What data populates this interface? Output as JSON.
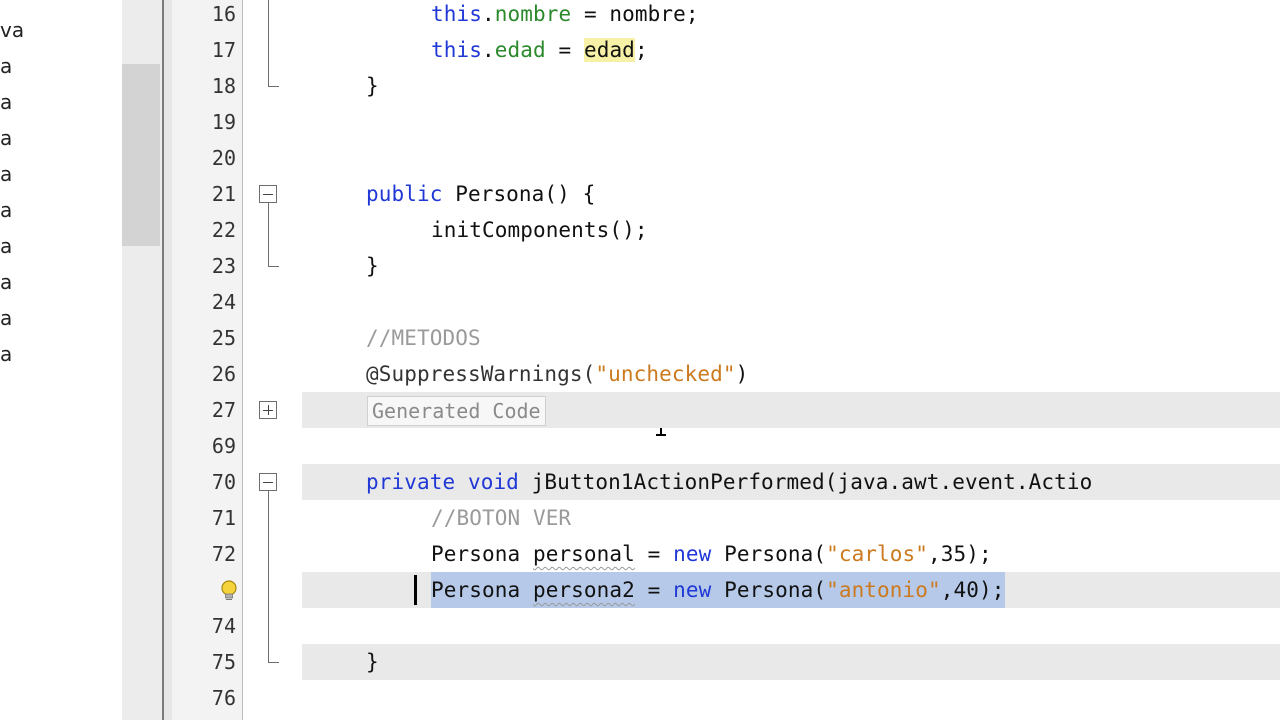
{
  "project_panel": {
    "items": [
      "va",
      "a",
      "a",
      "a",
      "a",
      "a",
      "a",
      "a",
      "a",
      "a"
    ]
  },
  "editor": {
    "lines": [
      {
        "num": "16",
        "code": [
          {
            "t": "this",
            "c": "kw"
          },
          {
            "t": ".",
            "c": ""
          },
          {
            "t": "nombre",
            "c": "fld"
          },
          {
            "t": " = nombre;",
            "c": ""
          }
        ]
      },
      {
        "num": "17",
        "code": [
          {
            "t": "this",
            "c": "kw"
          },
          {
            "t": ".",
            "c": ""
          },
          {
            "t": "edad",
            "c": "fld"
          },
          {
            "t": " = ",
            "c": ""
          },
          {
            "t": "edad",
            "c": "hl-yellow"
          },
          {
            "t": ";",
            "c": ""
          }
        ]
      },
      {
        "num": "18",
        "code": [
          {
            "t": "}",
            "c": ""
          }
        ]
      },
      {
        "num": "19",
        "code": []
      },
      {
        "num": "20",
        "code": []
      },
      {
        "num": "21",
        "code": [
          {
            "t": "public",
            "c": "kw"
          },
          {
            "t": " Persona() {",
            "c": ""
          }
        ]
      },
      {
        "num": "22",
        "code": [
          {
            "t": "initComponents();",
            "c": ""
          }
        ]
      },
      {
        "num": "23",
        "code": [
          {
            "t": "}",
            "c": ""
          }
        ]
      },
      {
        "num": "24",
        "code": []
      },
      {
        "num": "25",
        "code": [
          {
            "t": "//METODOS",
            "c": "cmt"
          }
        ]
      },
      {
        "num": "26",
        "code": [
          {
            "t": "@SuppressWarnings(",
            "c": "ann"
          },
          {
            "t": "\"unchecked\"",
            "c": "str"
          },
          {
            "t": ")",
            "c": ""
          }
        ]
      },
      {
        "num": "27",
        "code": [],
        "folded": "Generated Code"
      },
      {
        "num": "69",
        "code": []
      },
      {
        "num": "70",
        "code": [
          {
            "t": "private",
            "c": "kw"
          },
          {
            "t": " ",
            "c": ""
          },
          {
            "t": "void",
            "c": "kw"
          },
          {
            "t": " jButton1ActionPerformed(java.awt.event.Actio",
            "c": ""
          }
        ]
      },
      {
        "num": "71",
        "code": [
          {
            "t": "//BOTON VER",
            "c": "cmt"
          }
        ]
      },
      {
        "num": "72",
        "code": [
          {
            "t": "Persona ",
            "c": ""
          },
          {
            "t": "personal",
            "c": "squig"
          },
          {
            "t": " = ",
            "c": ""
          },
          {
            "t": "new",
            "c": "kw"
          },
          {
            "t": " Persona(",
            "c": ""
          },
          {
            "t": "\"carlos\"",
            "c": "str"
          },
          {
            "t": ",35);",
            "c": ""
          }
        ]
      },
      {
        "num": "",
        "code": [
          {
            "t": "Persona ",
            "c": ""
          },
          {
            "t": "persona2",
            "c": "squig"
          },
          {
            "t": " = ",
            "c": ""
          },
          {
            "t": "new",
            "c": "kw"
          },
          {
            "t": " Persona(",
            "c": ""
          },
          {
            "t": "\"antonio\"",
            "c": "str"
          },
          {
            "t": ",40);",
            "c": ""
          }
        ],
        "selected": true,
        "hint": "lightbulb-icon"
      },
      {
        "num": "74",
        "code": []
      },
      {
        "num": "75",
        "code": [
          {
            "t": "}",
            "c": ""
          }
        ]
      },
      {
        "num": "76",
        "code": []
      }
    ]
  },
  "colors": {
    "keyword": "#1f38d6",
    "field": "#2c8a2c",
    "string": "#cc7a1f",
    "comment": "#9a9a9a",
    "selection": "#b6c9e8",
    "highlight": "#f6f1a6"
  }
}
